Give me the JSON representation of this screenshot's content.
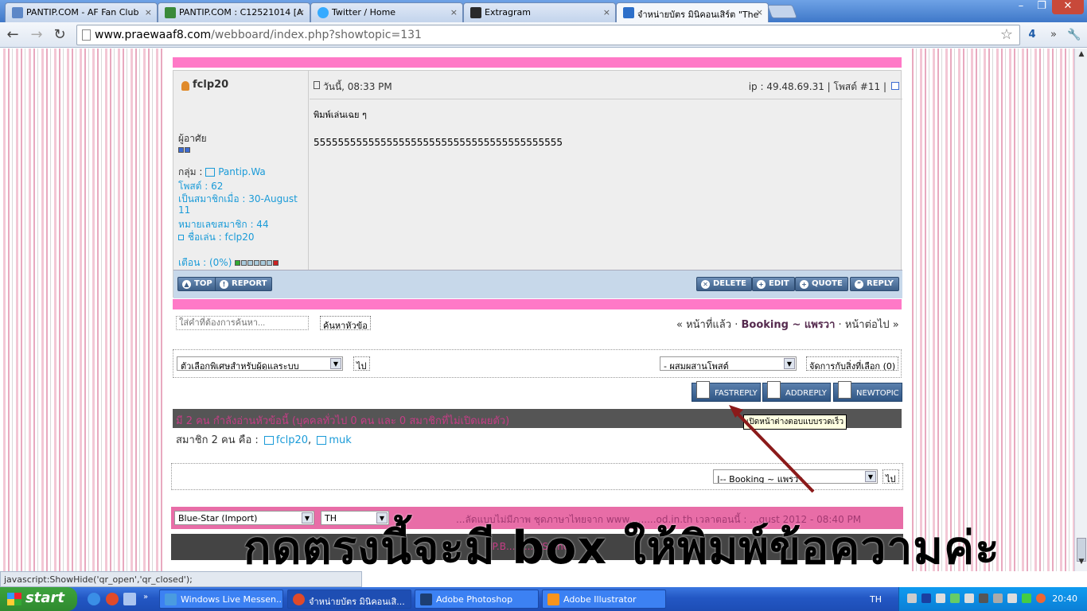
{
  "tabs": [
    {
      "title": "PANTIP.COM - AF Fan Club",
      "color": "#5c87c7"
    },
    {
      "title": "PANTIP.COM : C12521014 [A",
      "color": "#3a8a3a"
    },
    {
      "title": "Twitter / Home",
      "color": "#35aaff"
    },
    {
      "title": "Extragram",
      "color": "#2a2a2a"
    },
    {
      "title": "จำหน่ายบัตร มินิคอนเสิร์ต \"The",
      "color": "#2d6fc9"
    }
  ],
  "close_glyph": "×",
  "window_controls": {
    "minimize": "–",
    "maximize": "❐",
    "close": "✕"
  },
  "url": {
    "host": "www.praewaaf8.com",
    "path": "/webboard/index.php?showtopic=131"
  },
  "toolbar": {
    "back": "←",
    "forward": "→",
    "reload": "↻",
    "star": "☆",
    "ext": "4",
    "more": "»",
    "wrench": "🔧"
  },
  "post": {
    "username": "fclp20",
    "datetime": "วันนี้, 08:33 PM",
    "ip_info": "ip : 49.48.69.31 | โพสต์ #11 |",
    "rank": "ผู้อาศัย",
    "group_label": "กลุ่ม : ",
    "group": "Pantip.Wa",
    "posts": "โพสต์ : 62",
    "joined": "เป็นสมาชิกเมื่อ : 30-August",
    "joined2": "11",
    "member_no": "หมายเลขสมาชิก : 44",
    "nickname": "ชื่อเล่น : fclp20",
    "warn": "เตือน : (0%)",
    "body_line1": "พิมพ์เล่นเฉย ๆ",
    "body_line2": "55555555555555555555555555555555555555555"
  },
  "post_buttons": {
    "top": "TOP",
    "report": "REPORT",
    "delete": "DELETE",
    "edit": "EDIT",
    "quote": "QUOTE",
    "reply": "REPLY"
  },
  "search": {
    "placeholder": "ใส่คำที่ต้องการค้นหา...",
    "button": "ค้นหาหัวข้อ"
  },
  "nav": {
    "prev": "« หน้าที่แล้ว",
    "sep": "·",
    "forum": "Booking ~ แพรวา",
    "next": "หน้าต่อไป »"
  },
  "options": {
    "moderator_select": "ตัวเลือกพิเศษสำหรับผู้ดูแลระบบ",
    "go": "ไป",
    "merge_select": "- ผสมผสานโพสต์",
    "manage": "จัดการกับสิ่งที่เลือก (0)"
  },
  "action_buttons": {
    "fastreply": "FASTREPLY",
    "addreply": "ADDREPLY",
    "newtopic": "NEWTOPIC"
  },
  "viewers": "มี 2 คน กำลังอ่านหัวข้อนี้ (บุคคลทั่วไป 0 คน และ 0 สมาชิกที่ไม่เปิดเผยตัว)",
  "tooltip": "เปิดหน้าต่างตอบแบบรวดเร็ว",
  "members": {
    "label": "สมาชิก 2 คน คือ :",
    "m1": "fclp20",
    "m2": "muk"
  },
  "jump": {
    "select": "|-- Booking ~ แพรวา",
    "go": "ไป"
  },
  "footer": {
    "skin": "Blue-Star (Import)",
    "lang": "TH",
    "pink_text": "...ลัดแบบไม่มีภาพ  ชุดภาษาไทยจาก www.........od.in.th  เวลาตอนนี้ : ...gust 2012 - 08:40 PM",
    "dark_text": "IP.B..........PS, Inc."
  },
  "overlay_text": "กดตรงนี้จะมี box ให้พิมพ์ข้อความค่ะ",
  "statusbar": "javascript:ShowHide('qr_open','qr_closed');",
  "taskbar": {
    "start": "start",
    "tasks": [
      {
        "label": "Windows Live Messen...",
        "color": "#4a9be0"
      },
      {
        "label": "จำหน่ายบัตร มินิคอนเสิ...",
        "color": "#e04a2a"
      },
      {
        "label": "Adobe Photoshop",
        "color": "#1d3f73"
      },
      {
        "label": "Adobe Illustrator",
        "color": "#f7941d"
      }
    ],
    "lang": "TH",
    "clock": "20:40"
  }
}
